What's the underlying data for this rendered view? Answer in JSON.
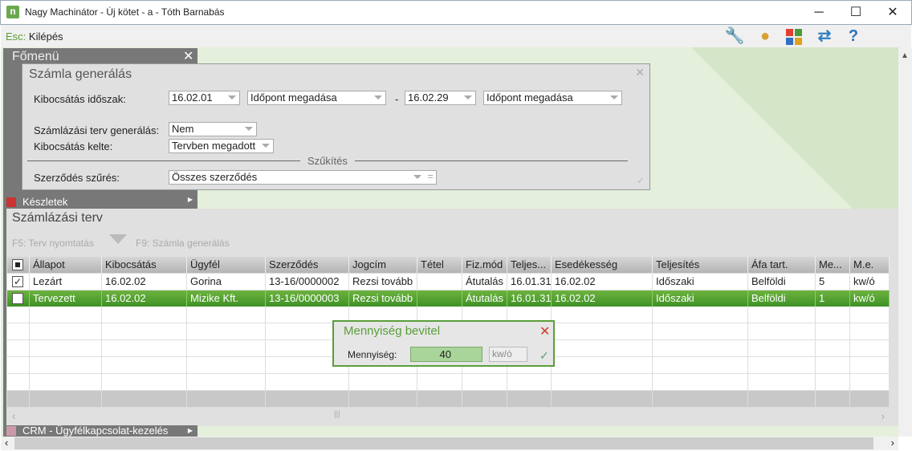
{
  "window": {
    "title": "Nagy Machinátor - Új kötet - a - Tóth Barnabás",
    "logo": "n",
    "minimize": "─",
    "maximize": "☐",
    "close": "✕"
  },
  "menubar": {
    "esc_key": "Esc:",
    "esc_label": "Kilépés",
    "tools": [
      "wrench-icon",
      "user-icon",
      "apps-grid-icon",
      "swap-arrows-icon",
      "help-icon"
    ]
  },
  "sidebar": {
    "title": "Főmenü",
    "close": "✕",
    "items": [
      {
        "label": "Készletek"
      },
      {
        "label": "CRM - Ügyfélkapcsolat-kezelés"
      }
    ]
  },
  "dialog": {
    "title": "Számla generálás",
    "close": "✕",
    "period_label": "Kibocsátás időszak:",
    "from_date": "16.02.01",
    "from_time": "Időpont megadása",
    "dash": "-",
    "to_date": "16.02.29",
    "to_time": "Időpont megadása",
    "plan_label": "Számlázási terv generálás:",
    "plan_value": "Nem",
    "issue_label": "Kibocsátás kelte:",
    "issue_value": "Tervben megadott",
    "section": "Szűkítés",
    "contract_label": "Szerződés szűrés:",
    "contract_value": "Összes szerződés",
    "ok": "✓"
  },
  "plan": {
    "title": "Számlázási terv",
    "f5": "F5: Terv nyomtatás",
    "f9": "F9: Számla generálás",
    "columns": [
      "",
      "Állapot",
      "Kibocsátás",
      "Ügyfél",
      "Szerződés",
      "Jogcím",
      "Tétel",
      "Fiz.mód",
      "Teljes...",
      "Esedékesség",
      "Teljesítés",
      "Áfa tart.",
      "Me...",
      "M.e."
    ],
    "rows": [
      {
        "checked": true,
        "cells": [
          "Lezárt",
          "16.02.02",
          "Gorina",
          "13-16/0000002",
          "Rezsi tovább",
          "",
          "Átutalás",
          "16.01.31",
          "16.02.02",
          "Időszaki",
          "Belföldi",
          "5",
          "kw/ó"
        ]
      },
      {
        "checked": false,
        "selected": true,
        "cells": [
          "Tervezett",
          "16.02.02",
          "Mizike Kft.",
          "13-16/0000003",
          "Rezsi tovább",
          "",
          "Átutalás",
          "16.01.31",
          "16.02.02",
          "Időszaki",
          "Belföldi",
          "1",
          "kw/ó"
        ]
      }
    ]
  },
  "popup": {
    "title": "Mennyiség bevitel",
    "label": "Mennyiség:",
    "value": "40",
    "unit": "kw/ó",
    "close": "✕",
    "ok": "✓"
  },
  "colors": {
    "accent": "#5a9e3a",
    "selected_row": "#4e9f2f"
  }
}
